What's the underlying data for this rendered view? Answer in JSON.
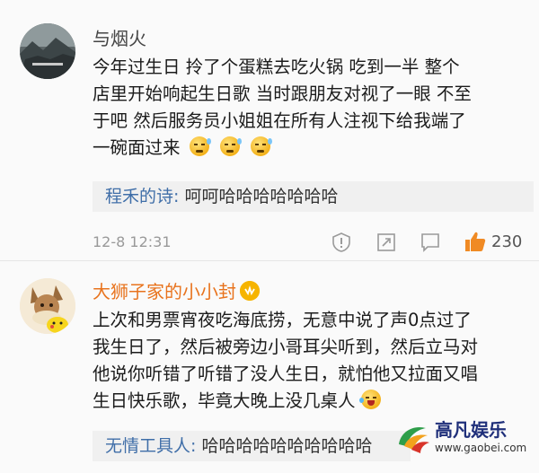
{
  "comments": [
    {
      "username": "与烟火",
      "avatar_icon": "landscape-avatar",
      "lines": [
        "今年过生日 拎了个蛋糕去吃火锅  吃到一半 整个",
        "店里开始响起生日歌 当时跟朋友对视了一眼  不至",
        "于吧 然后服务员小姐姐在所有人注视下给我端了",
        "一碗面过来"
      ],
      "emojis": [
        "sweat-smile-icon",
        "sweat-smile-icon",
        "sweat-smile-icon"
      ],
      "reply": {
        "name": "程禾的诗:",
        "text": "呵呵哈哈哈哈哈哈哈"
      },
      "timestamp": "12-8 12:31",
      "likes": "230"
    },
    {
      "username": "大狮子家的小小封",
      "username_color": "#e8731d",
      "avatar_icon": "eevee-pikachu-avatar",
      "badge_icon": "vip-badge-icon",
      "lines": [
        "上次和男票宵夜吃海底捞，无意中说了声0点过了",
        "我生日了，然后被旁边小哥耳尖听到，然后立马对",
        "他说你听错了听错了没人生日，就怕他又拉面又唱",
        "生日快乐歌，毕竟大晚上没几桌人"
      ],
      "emoji_end": "laugh-cry-icon",
      "reply": {
        "name": "无情工具人:",
        "text": "哈哈哈哈哈哈哈哈哈哈"
      }
    }
  ],
  "watermark": {
    "text": "高凡娱乐",
    "url": "www.gaobei.com"
  },
  "colors": {
    "link_blue": "#3f6ea8",
    "like_orange": "#f08a24",
    "orange_name": "#e8731d"
  }
}
